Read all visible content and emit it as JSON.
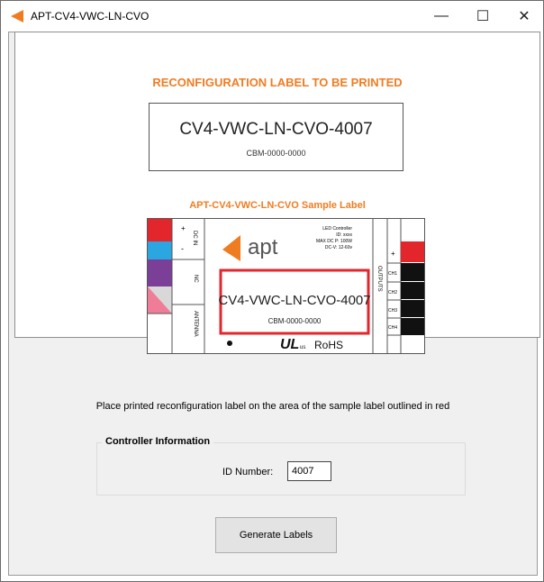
{
  "window": {
    "title": "APT-CV4-VWC-LN-CVO",
    "minimize_glyph": "—",
    "maximize_glyph": "☐",
    "close_glyph": "✕",
    "accent_color": "#f07c22"
  },
  "reconfig_label": {
    "heading": "RECONFIGURATION LABEL TO BE PRINTED",
    "model": "CV4-VWC-LN-CVO-4007",
    "cbm": "CBM-0000-0000"
  },
  "sample_label": {
    "heading": "APT-CV4-VWC-LN-CVO Sample Label",
    "brand": "apt",
    "dc_in": "DC IN",
    "plus": "+",
    "minus": "-",
    "nc": "NC",
    "antenna": "ANTENNA",
    "info_lines": [
      "LED Controller",
      "ID: xxxx",
      "MAX DC P: 100W",
      "DC-V: 12-60v"
    ],
    "model": "CV4-VWC-LN-CVO-4007",
    "cbm": "CBM-0000-0000",
    "outputs": "OUTPUTS",
    "channels": [
      "CH1",
      "CH2",
      "CH3",
      "CH4"
    ],
    "ul_mark": "UL",
    "ul_us": "us",
    "rohs": "RoHS",
    "outline_color": "#e3262c"
  },
  "instruction": "Place printed reconfiguration label on the area of the sample label outlined in red",
  "controller": {
    "legend": "Controller Information",
    "id_label": "ID Number:",
    "id_value": "4007"
  },
  "actions": {
    "generate_label": "Generate Labels"
  }
}
